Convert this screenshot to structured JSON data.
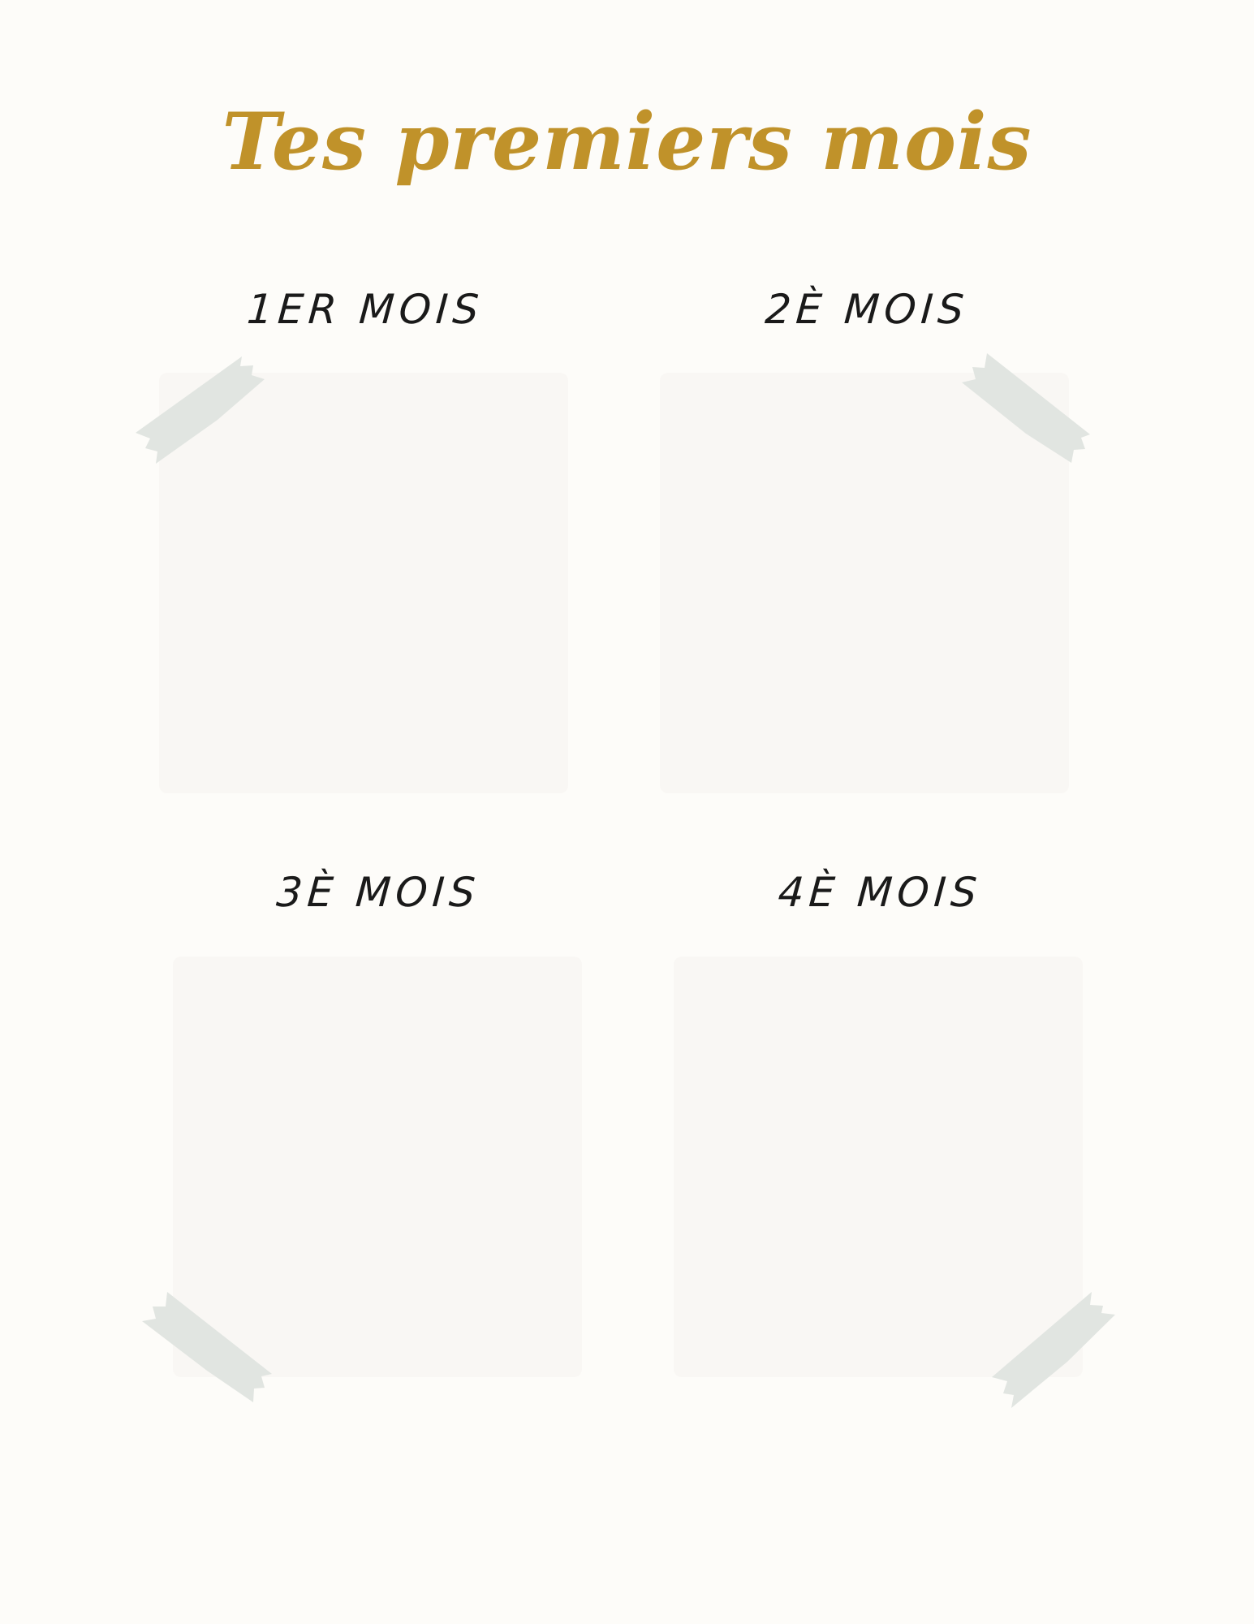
{
  "title": "Tes premiers mois",
  "months": [
    {
      "label": "1ER MOIS"
    },
    {
      "label": "2È MOIS"
    },
    {
      "label": "3È MOIS"
    },
    {
      "label": "4È MOIS"
    }
  ],
  "colors": {
    "background": "#fdfcf9",
    "title": "#c0922a",
    "photo_frame": "#f9f7f4",
    "tape": "#e1e5e1"
  }
}
